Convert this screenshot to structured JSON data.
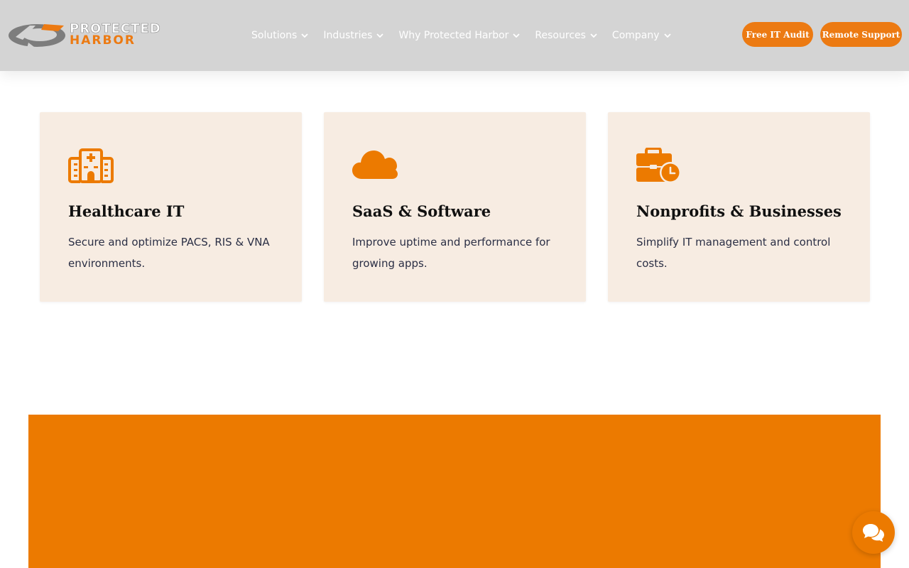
{
  "brand": {
    "name_top": "PROTECTED",
    "name_bottom": "HARBOR"
  },
  "nav": {
    "items": [
      {
        "label": "Solutions"
      },
      {
        "label": "Industries"
      },
      {
        "label": "Why Protected Harbor"
      },
      {
        "label": "Resources"
      },
      {
        "label": "Company"
      }
    ]
  },
  "cta": {
    "audit_label": "Free IT Audit",
    "support_label": "Remote Support"
  },
  "cards": [
    {
      "icon": "hospital-icon",
      "title": "Healthcare IT",
      "description": "Secure and optimize PACS, RIS & VNA environments."
    },
    {
      "icon": "cloud-icon",
      "title": "SaaS & Software",
      "description": "Improve uptime and performance for growing apps."
    },
    {
      "icon": "briefcase-clock-icon",
      "title": "Nonprofits & Businesses",
      "description": "Simplify IT management and control costs."
    }
  ],
  "colors": {
    "accent": "#ec7a00",
    "header_bg": "#d4d4d4",
    "card_bg": "#f7ece2"
  },
  "chat": {
    "icon": "chat-icon"
  }
}
